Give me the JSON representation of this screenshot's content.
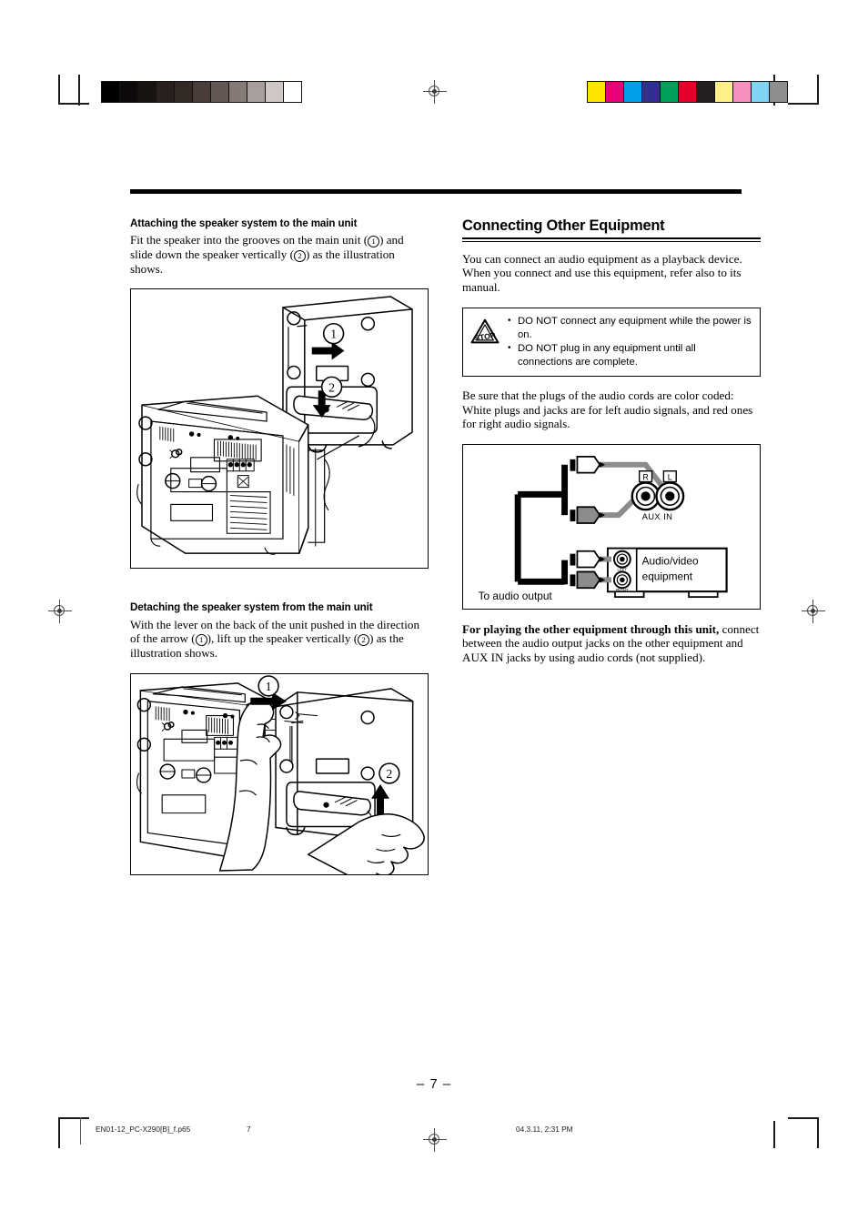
{
  "document": {
    "page_number": "– 7 –",
    "footer_file": "EN01-12_PC-X290[B]_f.p65",
    "footer_page": "7",
    "footer_timestamp": "04.3.11, 2:31 PM"
  },
  "print_marks": {
    "grayscale_wedge": [
      "#000000",
      "#0d0a09",
      "#191311",
      "#2a211e",
      "#332925",
      "#4a3d39",
      "#655854",
      "#857a76",
      "#a89e9b",
      "#cfc7c4",
      "#ffffff"
    ],
    "color_bars": [
      "#ffe400",
      "#e9007f",
      "#00a0e9",
      "#2e3192",
      "#00a05a",
      "#e4002b",
      "#231f20",
      "#fff089",
      "#f590c1",
      "#7fd3f3",
      "#8e8e8e"
    ]
  },
  "left_column": {
    "attaching": {
      "heading": "Attaching the speaker system to the main unit",
      "paragraph_part1": "Fit the speaker into the grooves on the main unit (",
      "marker1": "1",
      "paragraph_part2": ") and slide down the speaker vertically (",
      "marker2": "2",
      "paragraph_part3": ") as the illustration shows.",
      "figure_name": "attaching-speaker-illustration",
      "figure_callout_1": "1",
      "figure_callout_2": "2"
    },
    "detaching": {
      "heading": "Detaching the speaker system from the main unit",
      "paragraph_part1": "With the lever on the back of the unit pushed in the direction of the arrow (",
      "marker1": "1",
      "paragraph_part2": "), lift up the speaker vertically (",
      "marker2": "2",
      "paragraph_part3": ") as the illustration shows.",
      "figure_name": "detaching-speaker-illustration",
      "figure_callout_1": "1",
      "figure_callout_2": "2"
    }
  },
  "right_column": {
    "title": "Connecting Other Equipment",
    "intro": "You can connect an audio equipment as a playback device. When you connect and use this equipment, refer also to its manual.",
    "caution": {
      "icon_label": "STOP",
      "items": [
        "DO NOT connect any equipment while the power is on.",
        "DO NOT plug in any equipment until all connections are complete."
      ]
    },
    "color_code_note": "Be sure that the plugs of the audio cords are color coded: White plugs and jacks are for left audio signals, and red ones for right audio signals.",
    "diagram": {
      "jack_r_label": "R",
      "jack_l_label": "L",
      "aux_in_label": "AUX IN",
      "equipment_label_line1": "Audio/video",
      "equipment_label_line2": "equipment",
      "equipment_jack_left": "LEFT",
      "equipment_jack_right": "RIGHT",
      "to_audio_output_label": "To audio output"
    },
    "closing": {
      "bold_lead": "For playing the other equipment through this unit,",
      "rest": " connect between the audio output jacks on the other equipment and AUX IN jacks by using audio cords (not supplied)."
    }
  }
}
